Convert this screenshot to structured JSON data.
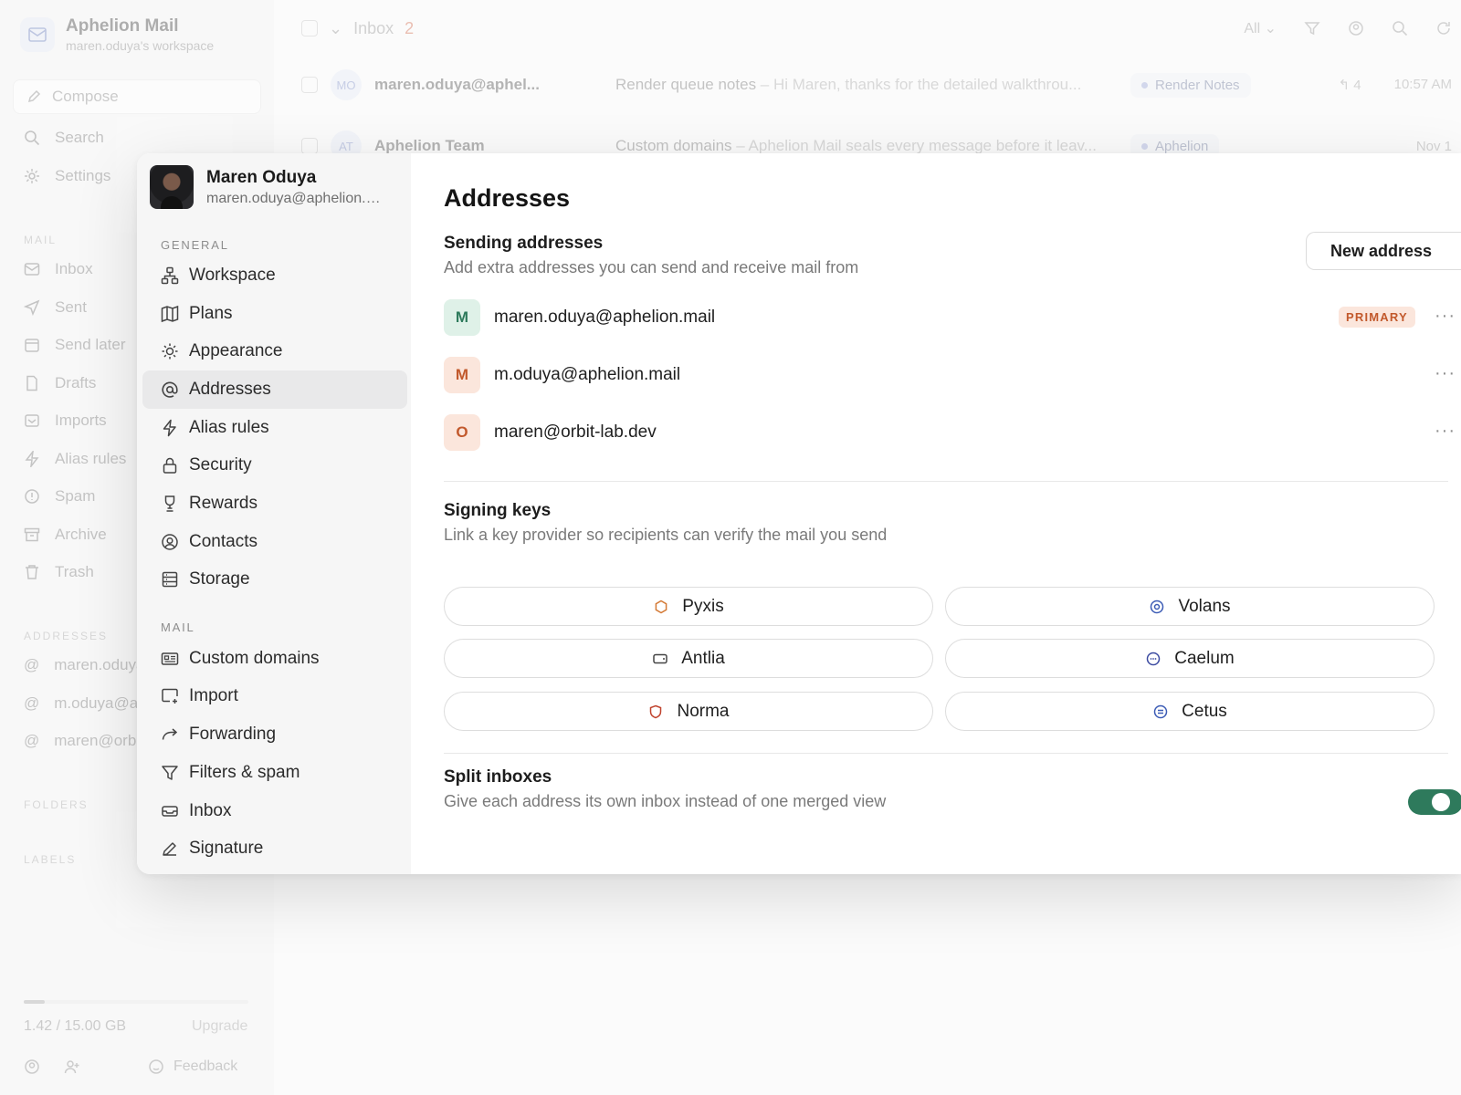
{
  "app": {
    "brand_name": "Aphelion Mail",
    "workspace": "maren.oduya's workspace",
    "compose": "Compose",
    "nav_top": [
      {
        "label": "Search",
        "icon": "search-icon"
      },
      {
        "label": "Settings",
        "icon": "gear-icon"
      }
    ],
    "mail_section": "MAIL",
    "mail_items": [
      {
        "label": "Inbox",
        "icon": "inbox-icon"
      },
      {
        "label": "Sent",
        "icon": "send-icon"
      },
      {
        "label": "Send later",
        "icon": "calendar-icon"
      },
      {
        "label": "Drafts",
        "icon": "file-icon"
      },
      {
        "label": "Imports",
        "icon": "import-icon"
      },
      {
        "label": "Alias rules",
        "icon": "bolt-icon"
      },
      {
        "label": "Spam",
        "icon": "spam-icon"
      },
      {
        "label": "Archive",
        "icon": "archive-icon"
      },
      {
        "label": "Trash",
        "icon": "trash-icon"
      }
    ],
    "addresses_section": "ADDRESSES",
    "address_items": [
      "maren.oduya@aphelion.mail",
      "m.oduya@aphelion.mail",
      "maren@orbit-lab.dev"
    ],
    "folders_section": "FOLDERS",
    "labels_section": "LABELS",
    "storage_used": "1.42 / 15.00 GB",
    "storage_fraction": 0.095,
    "upgrade": "Upgrade",
    "feedback": "Feedback"
  },
  "inbox": {
    "title": "Inbox",
    "unread_count": "2",
    "filter": "All",
    "rows": [
      {
        "initials": "MO",
        "from": "maren.oduya@aphel...",
        "subject": "Render queue notes",
        "preview": " – Hi Maren, thanks for the detailed walkthrou...",
        "label": "Render Notes",
        "replies": "4",
        "time": "10:57 AM"
      },
      {
        "initials": "AT",
        "from": "Aphelion Team",
        "subject": "Custom domains",
        "preview": " – Aphelion Mail seals every message before it leav...",
        "label": "Aphelion",
        "replies": "",
        "time": "Nov 1"
      }
    ]
  },
  "settings": {
    "user_name": "Maren Oduya",
    "user_email": "maren.oduya@aphelion.mail",
    "general_section": "GENERAL",
    "general_items": [
      {
        "label": "Workspace",
        "icon": "workspace-icon"
      },
      {
        "label": "Plans",
        "icon": "map-icon"
      },
      {
        "label": "Appearance",
        "icon": "sun-icon"
      },
      {
        "label": "Addresses",
        "icon": "at-icon"
      },
      {
        "label": "Alias rules",
        "icon": "bolt-icon"
      },
      {
        "label": "Security",
        "icon": "lock-icon"
      },
      {
        "label": "Rewards",
        "icon": "trophy-icon"
      },
      {
        "label": "Contacts",
        "icon": "contact-icon"
      },
      {
        "label": "Storage",
        "icon": "storage-icon"
      }
    ],
    "mail_section": "MAIL",
    "mail_items": [
      {
        "label": "Custom domains",
        "icon": "domain-icon"
      },
      {
        "label": "Import",
        "icon": "import-icon"
      },
      {
        "label": "Forwarding",
        "icon": "forward-icon"
      },
      {
        "label": "Filters & spam",
        "icon": "filter-icon"
      },
      {
        "label": "Inbox",
        "icon": "inbox-icon"
      },
      {
        "label": "Signature",
        "icon": "pen-icon"
      }
    ],
    "page_title": "Addresses",
    "sending_title": "Sending addresses",
    "sending_desc": "Add extra addresses you can send and receive mail from",
    "new_address": "New address",
    "addresses": [
      {
        "initial": "M",
        "email": "maren.oduya@aphelion.mail",
        "badge": "PRIMARY",
        "bg": "#dff1e8",
        "fg": "#2e7a5c"
      },
      {
        "initial": "M",
        "email": "m.oduya@aphelion.mail",
        "badge": "",
        "bg": "#fbe6dc",
        "fg": "#c2592c"
      },
      {
        "initial": "O",
        "email": "maren@orbit-lab.dev",
        "badge": "",
        "bg": "#fbe6dc",
        "fg": "#c2592c"
      }
    ],
    "more_label": "···",
    "signing_title": "Signing keys",
    "signing_desc": "Link a key provider so recipients can verify the mail you send",
    "providers": [
      {
        "label": "Pyxis",
        "icon": "hexagon-icon",
        "color": "#d47a36"
      },
      {
        "label": "Volans",
        "icon": "target-icon",
        "color": "#3b5bb5"
      },
      {
        "label": "Antlia",
        "icon": "card-icon",
        "color": "#444444"
      },
      {
        "label": "Caelum",
        "icon": "dots-circle-icon",
        "color": "#3b4aa0"
      },
      {
        "label": "Norma",
        "icon": "shield-icon",
        "color": "#c0432e"
      },
      {
        "label": "Cetus",
        "icon": "lines-circle-icon",
        "color": "#3b5bb5"
      }
    ],
    "split_title": "Split inboxes",
    "split_desc": "Give each address its own inbox instead of one merged view",
    "split_enabled": true,
    "toggle_color": "#2e7a5c"
  }
}
